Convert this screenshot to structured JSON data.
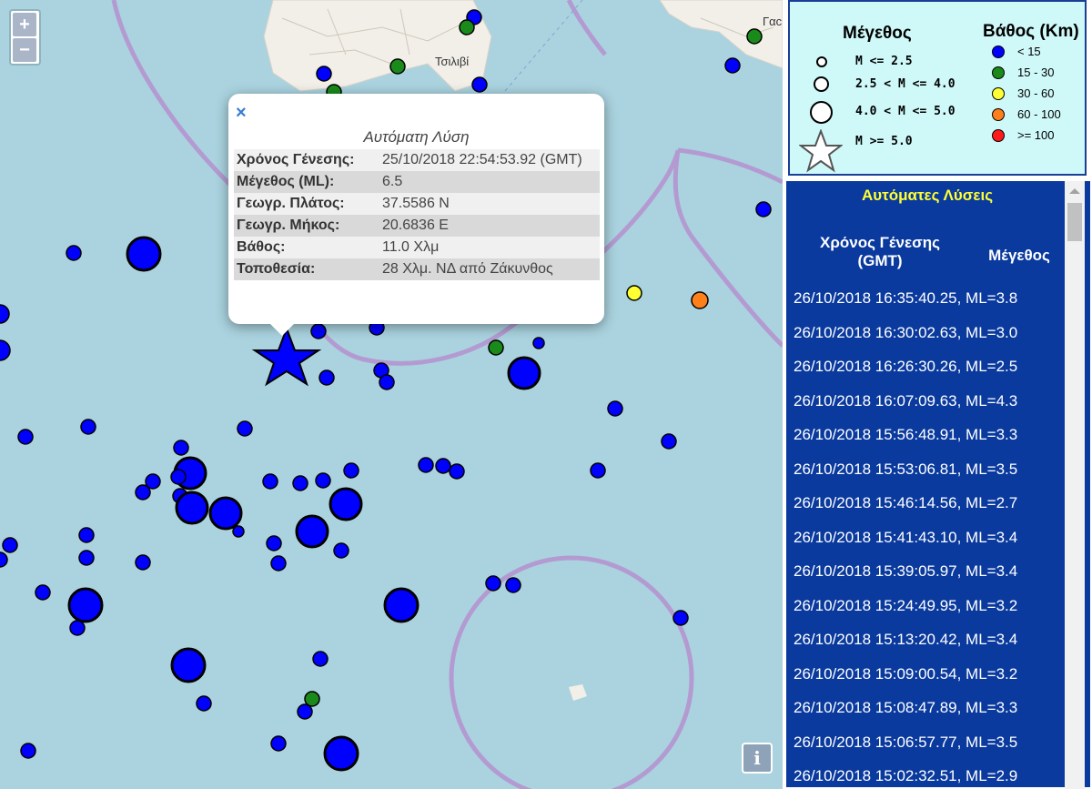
{
  "map": {
    "zoom_in_label": "+",
    "zoom_out_label": "−",
    "info_label": "i",
    "place_labels": [
      "Τσιλιβί",
      "Γαϲ"
    ],
    "colors": {
      "sea": "#aad3df",
      "land": "#f2efe9",
      "boundary": "#b39bd1",
      "blue": "#0000ff",
      "green": "#1a8a1a",
      "yellow": "#ffff33",
      "orange": "#ff7f1a"
    },
    "selected_event_marker": "star-icon"
  },
  "popup": {
    "close_label": "×",
    "title": "Αυτόματη Λύση",
    "rows": [
      {
        "key": "Χρόνος Γένεσης:",
        "value": "25/10/2018 22:54:53.92 (GMT)"
      },
      {
        "key": "Μέγεθος (ML):",
        "value": "6.5"
      },
      {
        "key": "Γεωγρ. Πλάτος:",
        "value": "37.5586 N"
      },
      {
        "key": "Γεωγρ. Μήκος:",
        "value": "20.6836 E"
      },
      {
        "key": "Βάθος:",
        "value": "11.0 Χλμ"
      },
      {
        "key": "Τοποθεσία:",
        "value": "28 Χλμ. ΝΔ από Ζάκυνθος"
      }
    ]
  },
  "legend": {
    "magnitude_title": "Μέγεθος",
    "depth_title": "Βάθος (Km)",
    "magnitude_items": [
      "M <= 2.5",
      "2.5 < M <= 4.0",
      "4.0 < M <= 5.0",
      "M >= 5.0"
    ],
    "depth_items": [
      {
        "label": "< 15",
        "color": "#0000ff"
      },
      {
        "label": "15 - 30",
        "color": "#1a8a1a"
      },
      {
        "label": "30 - 60",
        "color": "#ffff33"
      },
      {
        "label": "60 - 100",
        "color": "#ff7f1a"
      },
      {
        "label": ">= 100",
        "color": "#ff1a1a"
      }
    ]
  },
  "panel": {
    "title": "Αυτόματες Λύσεις",
    "col_time": "Χρόνος Γένεσης (GMT)",
    "col_mag": "Μέγεθος",
    "rows": [
      "26/10/2018 16:35:40.25, ML=3.8",
      "26/10/2018 16:30:02.63, ML=3.0",
      "26/10/2018 16:26:30.26, ML=2.5",
      "26/10/2018 16:07:09.63, ML=4.3",
      "26/10/2018 15:56:48.91, ML=3.3",
      "26/10/2018 15:53:06.81, ML=3.5",
      "26/10/2018 15:46:14.56, ML=2.7",
      "26/10/2018 15:41:43.10, ML=3.4",
      "26/10/2018 15:39:05.97, ML=3.4",
      "26/10/2018 15:24:49.95, ML=3.2",
      "26/10/2018 15:13:20.42, ML=3.4",
      "26/10/2018 15:09:00.54, ML=3.2",
      "26/10/2018 15:08:47.89, ML=3.3",
      "26/10/2018 15:06:57.77, ML=3.5",
      "26/10/2018 15:02:32.51, ML=2.9"
    ]
  }
}
